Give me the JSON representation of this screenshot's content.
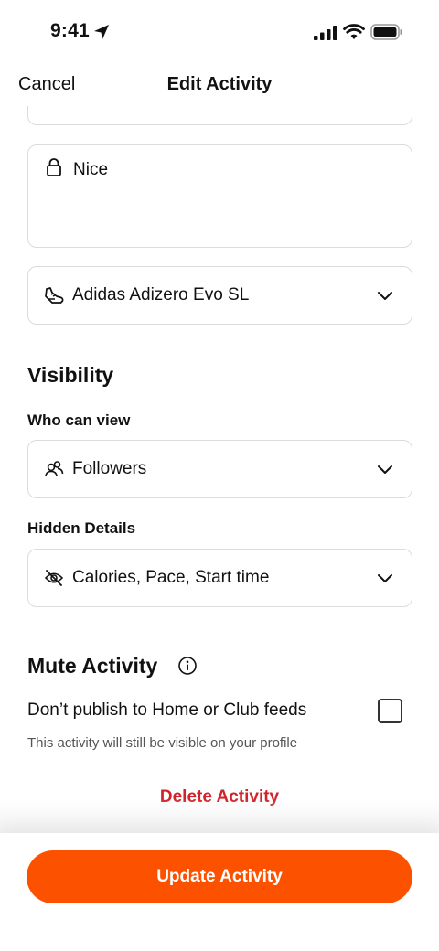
{
  "status_bar": {
    "time": "9:41",
    "icons": [
      "location-arrow-icon",
      "cellular-signal-icon",
      "wifi-icon",
      "battery-icon"
    ]
  },
  "nav": {
    "cancel_label": "Cancel",
    "title": "Edit Activity"
  },
  "description": {
    "icon": "lock-icon",
    "value": "Nice"
  },
  "gear": {
    "icon": "shoe-icon",
    "value": "Adidas Adizero Evo SL"
  },
  "visibility": {
    "title": "Visibility",
    "who_can_view": {
      "label": "Who can view",
      "icon": "people-icon",
      "value": "Followers"
    },
    "hidden_details": {
      "label": "Hidden Details",
      "icon": "eye-slash-icon",
      "value": "Calories, Pace, Start time"
    }
  },
  "mute": {
    "title": "Mute Activity",
    "toggle_label": "Don’t publish to Home or Club feeds",
    "checked": false,
    "note": "This activity will still be visible on your profile"
  },
  "delete_label": "Delete Activity",
  "update_label": "Update Activity",
  "colors": {
    "accent": "#fc5200",
    "danger": "#d1232a",
    "border": "#dcdcdc"
  }
}
